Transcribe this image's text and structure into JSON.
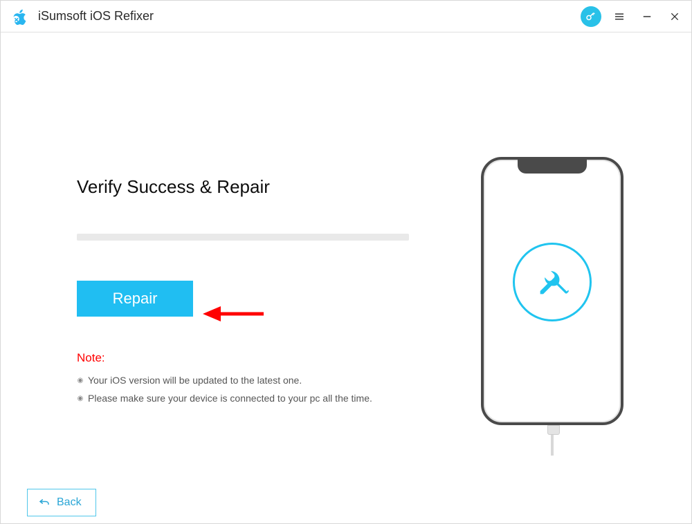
{
  "app": {
    "title": "iSumsoft iOS Refixer"
  },
  "main": {
    "heading": "Verify Success & Repair",
    "repair_label": "Repair",
    "note_label": "Note:",
    "notes": [
      "Your iOS version will be updated to the latest one.",
      "Please make sure your device is connected to your pc all the time."
    ]
  },
  "footer": {
    "back_label": "Back"
  },
  "icons": {
    "app_logo": "apple-wrench-logo",
    "key": "key-icon",
    "menu": "menu-icon",
    "minimize": "minimize-icon",
    "close": "close-icon",
    "tools": "tools-icon",
    "return": "return-arrow-icon"
  },
  "colors": {
    "accent": "#20bef2",
    "danger": "#ff0000"
  }
}
